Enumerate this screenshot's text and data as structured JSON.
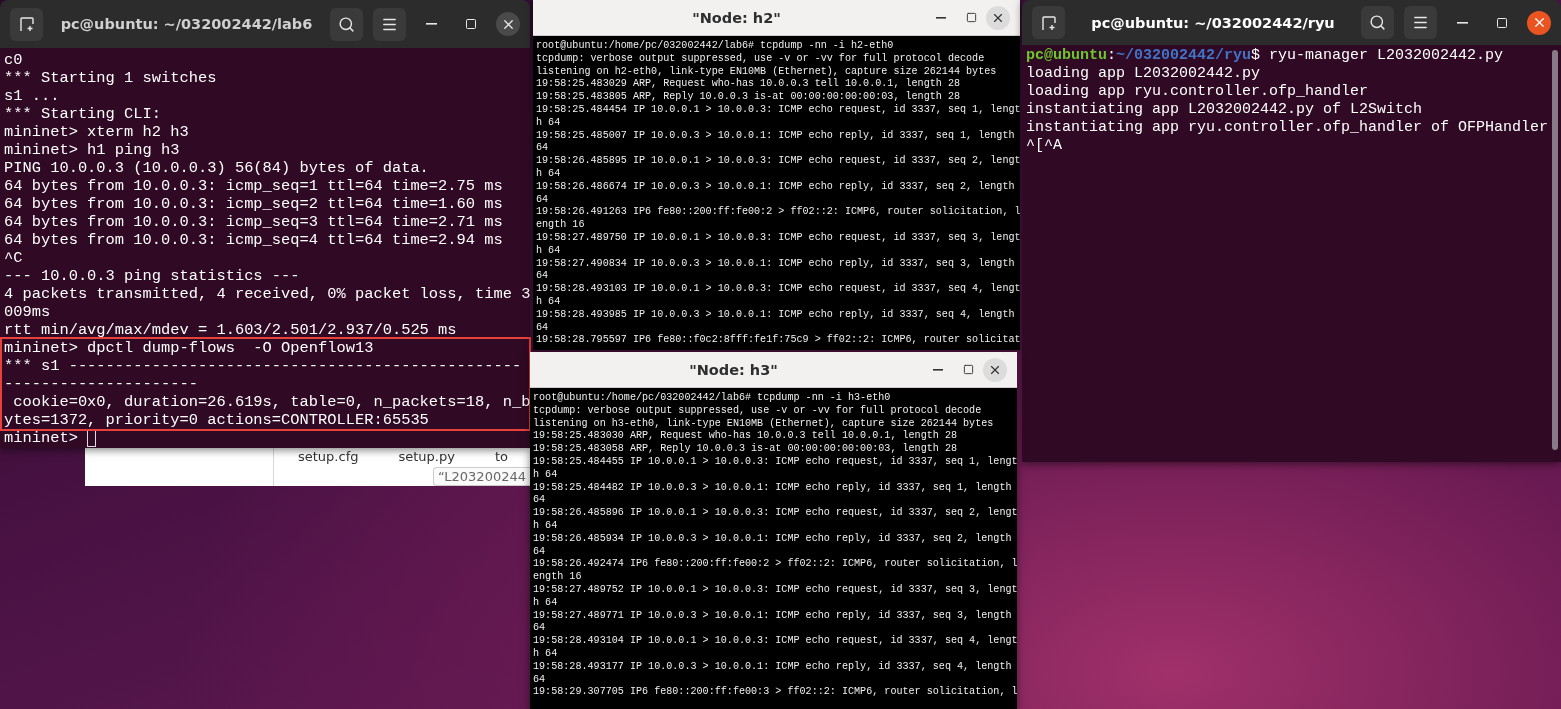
{
  "file_manager": {
    "files": [
      "setup.cfg",
      "setup.py",
      "to"
    ],
    "rename_label": "“L203200244"
  },
  "lab6_terminal": {
    "title": "pc@ubuntu: ~/032002442/lab6",
    "active": false,
    "lines": [
      "c0",
      "*** Starting 1 switches",
      "s1 ...",
      "*** Starting CLI:",
      "mininet> xterm h2 h3",
      "mininet> h1 ping h3",
      "PING 10.0.0.3 (10.0.0.3) 56(84) bytes of data.",
      "64 bytes from 10.0.0.3: icmp_seq=1 ttl=64 time=2.75 ms",
      "64 bytes from 10.0.0.3: icmp_seq=2 ttl=64 time=1.60 ms",
      "64 bytes from 10.0.0.3: icmp_seq=3 ttl=64 time=2.71 ms",
      "64 bytes from 10.0.0.3: icmp_seq=4 ttl=64 time=2.94 ms",
      "^C",
      "--- 10.0.0.3 ping statistics ---",
      "4 packets transmitted, 4 received, 0% packet loss, time 3",
      "009ms",
      "rtt min/avg/max/mdev = 1.603/2.501/2.937/0.525 ms"
    ],
    "highlighted_lines": [
      "mininet> dpctl dump-flows  -O Openflow13",
      "*** s1 -------------------------------------------------",
      "---------------------",
      " cookie=0x0, duration=26.619s, table=0, n_packets=18, n_b",
      "ytes=1372, priority=0 actions=CONTROLLER:65535"
    ],
    "prompt": "mininet> "
  },
  "h2_xterm": {
    "title": "\"Node: h2\"",
    "active": false,
    "lines": [
      "root@ubuntu:/home/pc/032002442/lab6# tcpdump -nn -i h2-eth0",
      "tcpdump: verbose output suppressed, use -v or -vv for full protocol decode",
      "listening on h2-eth0, link-type EN10MB (Ethernet), capture size 262144 bytes",
      "19:58:25.483029 ARP, Request who-has 10.0.0.3 tell 10.0.0.1, length 28",
      "19:58:25.483805 ARP, Reply 10.0.0.3 is-at 00:00:00:00:00:03, length 28",
      "19:58:25.484454 IP 10.0.0.1 > 10.0.0.3: ICMP echo request, id 3337, seq 1, lengt",
      "h 64",
      "19:58:25.485007 IP 10.0.0.3 > 10.0.0.1: ICMP echo reply, id 3337, seq 1, length",
      "64",
      "19:58:26.485895 IP 10.0.0.1 > 10.0.0.3: ICMP echo request, id 3337, seq 2, lengt",
      "h 64",
      "19:58:26.486674 IP 10.0.0.3 > 10.0.0.1: ICMP echo reply, id 3337, seq 2, length",
      "64",
      "19:58:26.491263 IP6 fe80::200:ff:fe00:2 > ff02::2: ICMP6, router solicitation, l",
      "ength 16",
      "19:58:27.489750 IP 10.0.0.1 > 10.0.0.3: ICMP echo request, id 3337, seq 3, lengt",
      "h 64",
      "19:58:27.490834 IP 10.0.0.3 > 10.0.0.1: ICMP echo reply, id 3337, seq 3, length",
      "64",
      "19:58:28.493103 IP 10.0.0.1 > 10.0.0.3: ICMP echo request, id 3337, seq 4, lengt",
      "h 64",
      "19:58:28.493985 IP 10.0.0.3 > 10.0.0.1: ICMP echo reply, id 3337, seq 4, length",
      "64",
      "19:58:28.795597 IP6 fe80::f0c2:8fff:fe1f:75c9 > ff02::2: ICMP6, router solicitat"
    ]
  },
  "ryu_terminal": {
    "title": "pc@ubuntu: ~/032002442/ryu",
    "active": true,
    "prompt": [
      {
        "kind": "user",
        "text": "pc@ubuntu"
      },
      {
        "kind": "plain",
        "text": ":"
      },
      {
        "kind": "path",
        "text": "~/032002442/ryu"
      },
      {
        "kind": "plain",
        "text": "$ ryu-manager L2032002442.py"
      }
    ],
    "lines": [
      "loading app L2032002442.py",
      "loading app ryu.controller.ofp_handler",
      "instantiating app L2032002442.py of L2Switch",
      "instantiating app ryu.controller.ofp_handler of OFPHandler",
      "^[^A"
    ]
  },
  "h3_xterm": {
    "title": "\"Node: h3\"",
    "active": false,
    "lines": [
      "root@ubuntu:/home/pc/032002442/lab6# tcpdump -nn -i h3-eth0",
      "tcpdump: verbose output suppressed, use -v or -vv for full protocol decode",
      "listening on h3-eth0, link-type EN10MB (Ethernet), capture size 262144 bytes",
      "19:58:25.483030 ARP, Request who-has 10.0.0.3 tell 10.0.0.1, length 28",
      "19:58:25.483058 ARP, Reply 10.0.0.3 is-at 00:00:00:00:00:03, length 28",
      "19:58:25.484455 IP 10.0.0.1 > 10.0.0.3: ICMP echo request, id 3337, seq 1, lengt",
      "h 64",
      "19:58:25.484482 IP 10.0.0.3 > 10.0.0.1: ICMP echo reply, id 3337, seq 1, length",
      "64",
      "19:58:26.485896 IP 10.0.0.1 > 10.0.0.3: ICMP echo request, id 3337, seq 2, lengt",
      "h 64",
      "19:58:26.485934 IP 10.0.0.3 > 10.0.0.1: ICMP echo reply, id 3337, seq 2, length",
      "64",
      "19:58:26.492474 IP6 fe80::200:ff:fe00:2 > ff02::2: ICMP6, router solicitation, l",
      "ength 16",
      "19:58:27.489752 IP 10.0.0.1 > 10.0.0.3: ICMP echo request, id 3337, seq 3, lengt",
      "h 64",
      "19:58:27.489771 IP 10.0.0.3 > 10.0.0.1: ICMP echo reply, id 3337, seq 3, length",
      "64",
      "19:58:28.493104 IP 10.0.0.1 > 10.0.0.3: ICMP echo request, id 3337, seq 4, lengt",
      "h 64",
      "19:58:28.493177 IP 10.0.0.3 > 10.0.0.1: ICMP echo reply, id 3337, seq 4, length",
      "64",
      "19:58:29.307705 IP6 fe80::200:ff:fe00:3 > ff02::2: ICMP6, router solicitation, l"
    ]
  }
}
